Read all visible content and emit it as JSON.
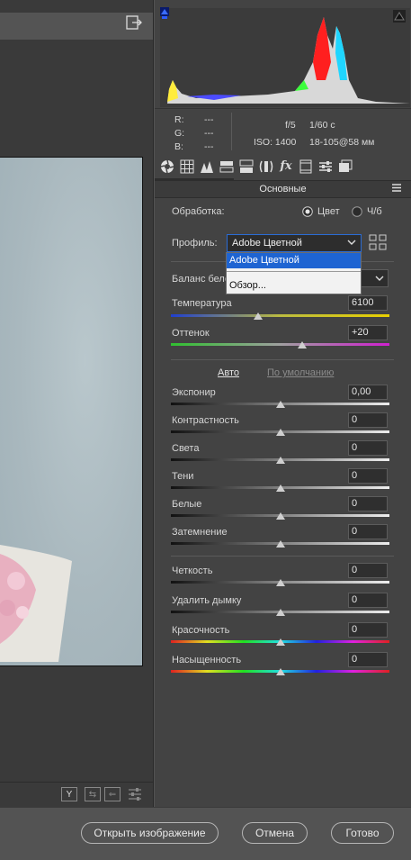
{
  "exif": {
    "r_label": "R:",
    "g_label": "G:",
    "b_label": "B:",
    "r_value": "---",
    "g_value": "---",
    "b_value": "---",
    "aperture": "f/5",
    "shutter": "1/60 с",
    "iso": "ISO: 1400",
    "lens": "18-105@58 мм"
  },
  "panel": {
    "section_title": "Основные",
    "processing_label": "Обработка:",
    "color_option": "Цвет",
    "bw_option": "Ч/б",
    "profile_label": "Профиль:",
    "profile_value": "Adobe Цветной",
    "profile_menu": [
      "Adobe Цветной",
      "Обзор..."
    ],
    "wb_label": "Баланс бело",
    "temperature_label": "Температура",
    "temperature_value": "6100",
    "tint_label": "Оттенок",
    "tint_value": "+20",
    "auto_link": "Авто",
    "default_link": "По умолчанию"
  },
  "sliders": [
    {
      "label": "Экспонир",
      "value": "0,00",
      "position": 0.5
    },
    {
      "label": "Контрастность",
      "value": "0",
      "position": 0.5
    },
    {
      "label": "Света",
      "value": "0",
      "position": 0.5
    },
    {
      "label": "Тени",
      "value": "0",
      "position": 0.5
    },
    {
      "label": "Белые",
      "value": "0",
      "position": 0.5
    },
    {
      "label": "Затемнение",
      "value": "0",
      "position": 0.5
    },
    {
      "label": "Четкость",
      "value": "0",
      "position": 0.5
    },
    {
      "label": "Удалить дымку",
      "value": "0",
      "position": 0.5
    },
    {
      "label": "Красочность",
      "value": "0",
      "position": 0.5
    },
    {
      "label": "Насыщенность",
      "value": "0",
      "position": 0.5
    }
  ],
  "temperature_position": 0.4,
  "tint_position": 0.6,
  "preview_icons": [
    "Y"
  ],
  "buttons": {
    "open": "Открыть изображение",
    "cancel": "Отмена",
    "done": "Готово"
  },
  "colors": {
    "accent": "#2b6cd4",
    "panel_bg": "#434343"
  }
}
